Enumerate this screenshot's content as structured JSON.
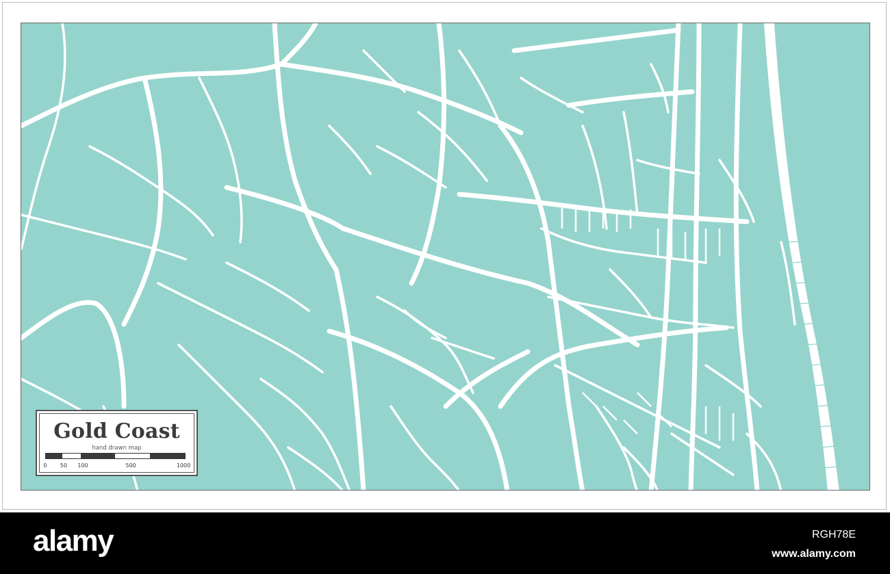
{
  "map": {
    "title": "Gold Coast",
    "subtitle": "hand drawn map",
    "scale_labels": [
      "0",
      "50",
      "100",
      "500",
      "1000"
    ],
    "colors": {
      "land": "#94d4cc",
      "roads": "#ffffff",
      "frame": "#6a6a6a"
    }
  },
  "footer": {
    "logo": "alamy",
    "image_id": "RGH78E",
    "url": "www.alamy.com"
  }
}
